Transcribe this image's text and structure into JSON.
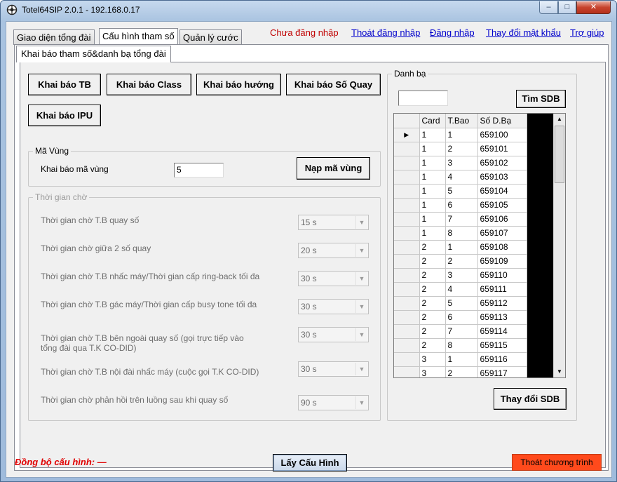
{
  "window": {
    "title": "Totel64SIP 2.0.1 - 192.168.0.17",
    "min": "–",
    "max": "□",
    "close": "✕"
  },
  "tabs": [
    "Giao diện tổng đài",
    "Cấu hình tham số",
    "Quản lý cước"
  ],
  "status": {
    "text": "Chưa đăng nhập",
    "color": "#c00000"
  },
  "links": [
    "Thoát đăng nhập",
    "Đăng nhập",
    "Thay đổi mật khẩu",
    "Trợ giúp"
  ],
  "subtab": "Khai báo tham số&danh bạ tổng đài",
  "declare_buttons": [
    "Khai báo TB",
    "Khai báo Class",
    "Khai báo hướng",
    "Khai báo Số Quay",
    "Khai báo IPU"
  ],
  "area": {
    "legend": "Mã Vùng",
    "label": "Khai báo mã vùng",
    "value": "5",
    "button": "Nạp mã vùng"
  },
  "wait": {
    "legend": "Thời gian chờ",
    "rows": [
      {
        "label": "Thời gian chờ T.B quay số",
        "value": "15 s"
      },
      {
        "label": "Thời gian chờ giữa 2 số quay",
        "value": "20 s"
      },
      {
        "label": "Thời gian chờ T.B nhấc máy/Thời gian cấp ring-back tối đa",
        "value": "30 s"
      },
      {
        "label": "Thời gian chờ T.B gác máy/Thời gian cấp busy tone tối đa",
        "value": "30 s"
      },
      {
        "label": "Thời gian chờ T.B bên ngoài quay số (gọi trực tiếp vào",
        "label2": "tổng đài qua T.K CO-DID)",
        "value": "30 s"
      },
      {
        "label": "Thời gian chờ T.B nội đài nhấc máy (cuộc gọi T.K CO-DID)",
        "value": "30 s"
      },
      {
        "label": "Thời gian chờ phản hồi trên luồng sau khi quay số",
        "value": "90 s"
      }
    ]
  },
  "phonebook": {
    "legend": "Danh bạ",
    "search_value": "",
    "search_button": "Tìm SDB",
    "columns": [
      "Card",
      "T.Bao",
      "Số D.Bạ"
    ],
    "rows": [
      [
        "1",
        "1",
        "659100"
      ],
      [
        "1",
        "2",
        "659101"
      ],
      [
        "1",
        "3",
        "659102"
      ],
      [
        "1",
        "4",
        "659103"
      ],
      [
        "1",
        "5",
        "659104"
      ],
      [
        "1",
        "6",
        "659105"
      ],
      [
        "1",
        "7",
        "659106"
      ],
      [
        "1",
        "8",
        "659107"
      ],
      [
        "2",
        "1",
        "659108"
      ],
      [
        "2",
        "2",
        "659109"
      ],
      [
        "2",
        "3",
        "659110"
      ],
      [
        "2",
        "4",
        "659111"
      ],
      [
        "2",
        "5",
        "659112"
      ],
      [
        "2",
        "6",
        "659113"
      ],
      [
        "2",
        "7",
        "659114"
      ],
      [
        "2",
        "8",
        "659115"
      ],
      [
        "3",
        "1",
        "659116"
      ],
      [
        "3",
        "2",
        "659117"
      ]
    ],
    "change_button": "Thay đổi SDB"
  },
  "footer": {
    "sync_label": "Đồng bộ cấu hình: —",
    "get_config": "Lấy Cấu Hình",
    "exit": "Thoát chương trình"
  }
}
